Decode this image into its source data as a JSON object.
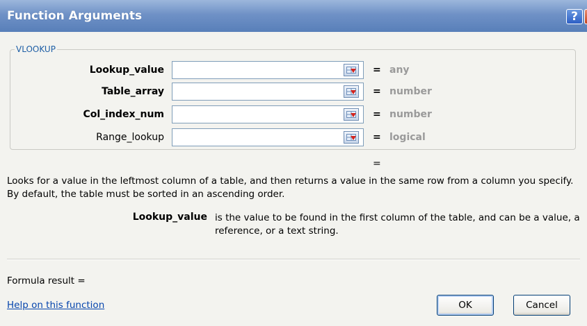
{
  "window": {
    "title": "Function Arguments"
  },
  "titlebar_buttons": {
    "help": "?",
    "close": "X"
  },
  "function_group": {
    "name": "VLOOKUP"
  },
  "arguments": [
    {
      "label": "Lookup_value",
      "value": "",
      "type": "any",
      "bold": true
    },
    {
      "label": "Table_array",
      "value": "",
      "type": "number",
      "bold": true
    },
    {
      "label": "Col_index_num",
      "value": "",
      "type": "number",
      "bold": true
    },
    {
      "label": "Range_lookup",
      "value": "",
      "type": "logical",
      "bold": false
    }
  ],
  "equals_sign": "=",
  "result_equals": "=",
  "description": "Looks for a value in the leftmost column of a table, and then returns a value in the same row from a column you specify. By default, the table must be sorted in an ascending order.",
  "argument_help": {
    "name": "Lookup_value",
    "text": "is the value to be found in the first column of the table, and can be a value, a reference, or a text string."
  },
  "formula_result": "Formula result =",
  "help_link": "Help on this function",
  "buttons": {
    "ok": "OK",
    "cancel": "Cancel"
  },
  "icons": {
    "range_selector": "range-selector-icon"
  },
  "colors": {
    "titlebar": "#6f91c6",
    "legend": "#1f5fa6",
    "type_text": "#9a9a9a",
    "link": "#0645ad"
  }
}
